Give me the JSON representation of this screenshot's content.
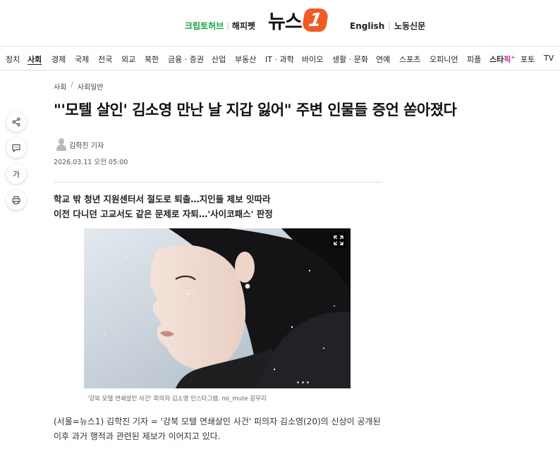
{
  "header": {
    "left_links": [
      "크립토허브",
      "해피펫"
    ],
    "logo_text": "뉴스",
    "logo_badge": "1",
    "right_links": [
      "English",
      "노동신문"
    ]
  },
  "nav": {
    "items": [
      "정치",
      "사회",
      "경제",
      "국제",
      "전국",
      "외교",
      "북한",
      "금융 · 증권",
      "산업",
      "부동산",
      "IT · 과학",
      "바이오",
      "생활 · 문화",
      "연예",
      "스포츠",
      "오피니언",
      "피플",
      "스타픽",
      "포토",
      "TV"
    ],
    "active": "사회",
    "star_part1": "스타",
    "star_part2": "픽",
    "star_sup": "+"
  },
  "breadcrumb": {
    "section": "사회",
    "separator": "/",
    "subsection": "사회일반"
  },
  "article": {
    "headline": "\"'모텔 살인' 김소영 만난 날 지갑 잃어\" 주변 인물들 증언 쏟아졌다",
    "author": "김학진 기자",
    "date": "2026.03.11 오전 05:00",
    "summary_line1": "학교 밖 청년 지원센터서 절도로 퇴출…지인들 제보 잇따라",
    "summary_line2": "이전 다니던 고교서도 같은 문제로 자퇴…'사이코패스' 판정",
    "caption": "'강북 모텔 연쇄살인 사건' 피의자 김소영 인스타그램. no_mute 갈무리",
    "body_line1": "(서울=뉴스1) 김학진 기자 = '강북 모텔 연쇄살인 사건' 피의자 김소영(20)의 신상이 공개된",
    "body_line2": "이후 과거 행적과 관련된 제보가 이어지고 있다."
  },
  "side_tools": {
    "font_label": "가"
  },
  "colors": {
    "accent_orange": "#f15a24",
    "green": "#12a340",
    "pink": "#c1309a"
  }
}
